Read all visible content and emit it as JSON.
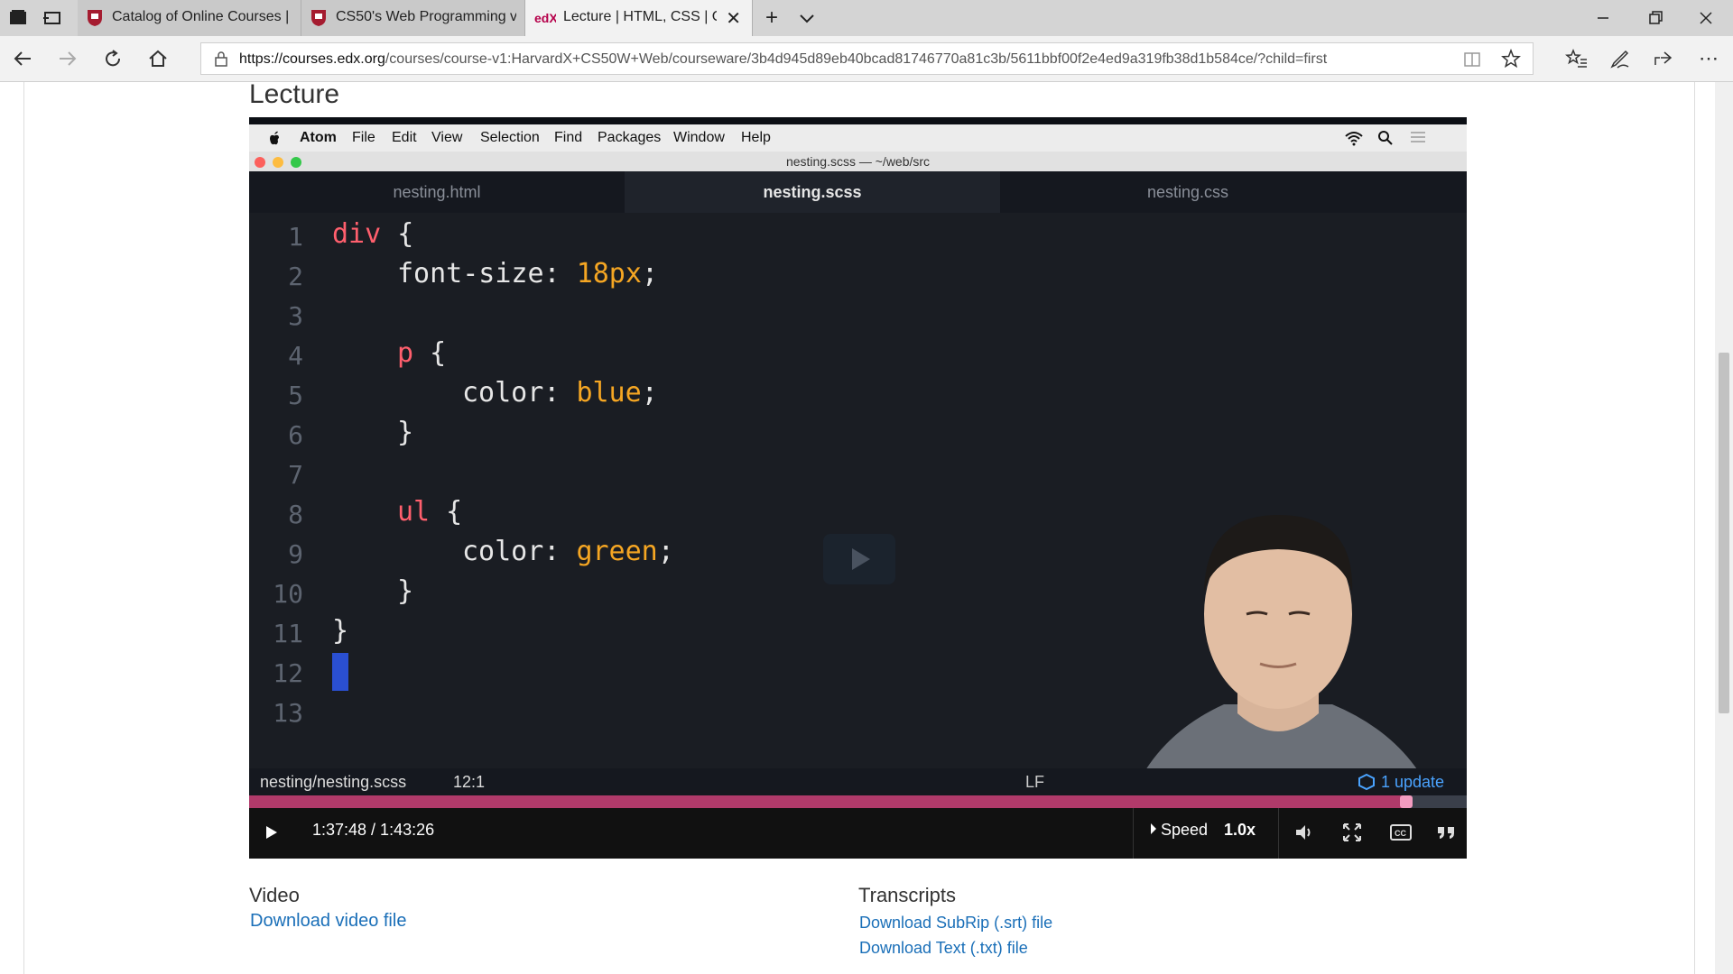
{
  "browser": {
    "tabs": [
      {
        "label": "Catalog of Online Courses |",
        "icon": "harvard-shield-icon"
      },
      {
        "label": "CS50's Web Programming v",
        "icon": "harvard-shield-icon"
      },
      {
        "label": "Lecture | HTML, CSS | C:",
        "icon": "edx-icon"
      }
    ],
    "url_host": "https://courses.edx.org",
    "url_path": "/courses/course-v1:HarvardX+CS50W+Web/courseware/3b4d945d89eb40bcad81746770a81c3b/5611bbf00f2e4ed9a319fb38d1b584ce/?child=first"
  },
  "page": {
    "title": "Lecture"
  },
  "video": {
    "mac_menu": [
      "Atom",
      "File",
      "Edit",
      "View",
      "Selection",
      "Find",
      "Packages",
      "Window",
      "Help"
    ],
    "window_title": "nesting.scss — ~/web/src",
    "editor_tabs": [
      "nesting.html",
      "nesting.scss",
      "nesting.css"
    ],
    "line_numbers": [
      "1",
      "2",
      "3",
      "4",
      "5",
      "6",
      "7",
      "8",
      "9",
      "10",
      "11",
      "12",
      "13"
    ],
    "code": {
      "l1_sel": "div",
      "l1_rest": " {",
      "l2_prop": "font-size: ",
      "l2_val": "18px",
      "l2_end": ";",
      "l4_sel": "p",
      "l4_rest": " {",
      "l5_prop": "color: ",
      "l5_val": "blue",
      "l5_end": ";",
      "l6": "}",
      "l8_sel": "ul",
      "l8_rest": " {",
      "l9_prop": "color: ",
      "l9_val": "green",
      "l9_end": ";",
      "l10": "}",
      "l11": "}"
    },
    "status_file": "nesting/nesting.scss",
    "status_pos": "12:1",
    "status_lf": "LF",
    "status_update": "1 update",
    "time": "1:37:48 / 1:43:26",
    "progress": 0.9507,
    "speed_label": "Speed",
    "speed_value": "1.0x"
  },
  "below": {
    "video_head": "Video",
    "video_link": "Download video file",
    "transcripts_head": "Transcripts",
    "srt_link": "Download SubRip (.srt) file",
    "txt_link": "Download Text (.txt) file"
  },
  "colors": {
    "progress_fill": "#b03a6a",
    "link": "#1a6fb8"
  }
}
